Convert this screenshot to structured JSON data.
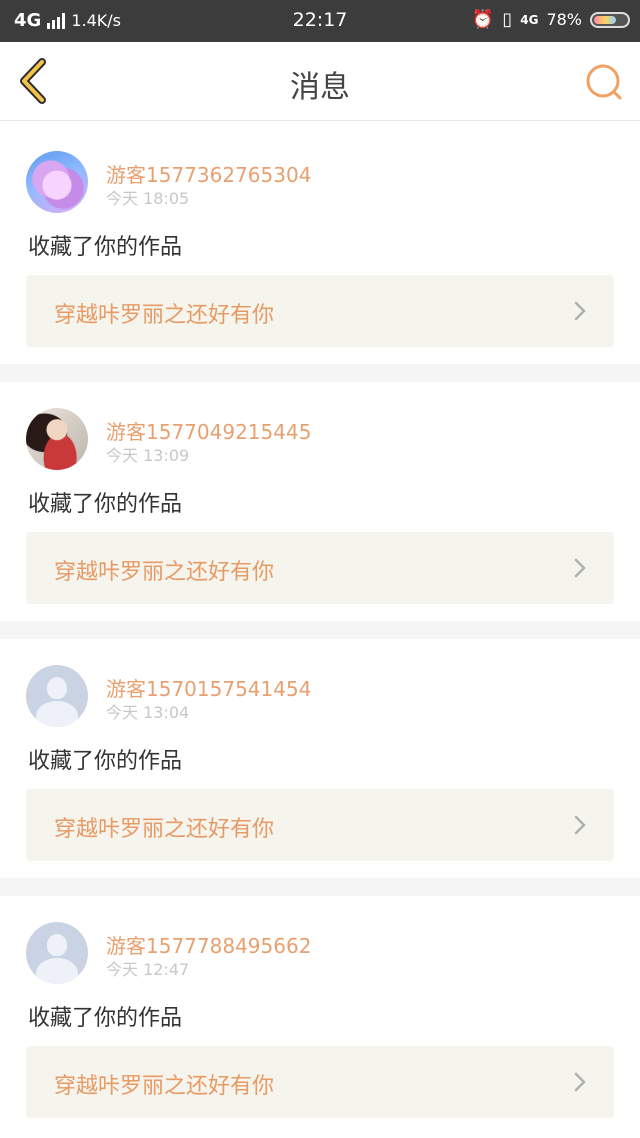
{
  "status_bar": {
    "network": "4G",
    "speed": "1.4K/s",
    "time": "22:17",
    "network_right": "4G",
    "battery": "78%",
    "colors": {
      "bg": "#3c3c3c",
      "text": "#ffffff"
    }
  },
  "header": {
    "title": "消息",
    "back_icon": "chevron-left-icon",
    "search_icon": "search-icon",
    "accent_color": "#f0a060"
  },
  "messages": [
    {
      "username": "游客1577362765304",
      "time": "今天  18:05",
      "action": "收藏了你的作品",
      "work_title": "穿越咔罗丽之还好有你",
      "avatar": "flower"
    },
    {
      "username": "游客1577049215445",
      "time": "今天  13:09",
      "action": "收藏了你的作品",
      "work_title": "穿越咔罗丽之还好有你",
      "avatar": "photo"
    },
    {
      "username": "游客1570157541454",
      "time": "今天  13:04",
      "action": "收藏了你的作品",
      "work_title": "穿越咔罗丽之还好有你",
      "avatar": "default"
    },
    {
      "username": "游客1577788495662",
      "time": "今天  12:47",
      "action": "收藏了你的作品",
      "work_title": "穿越咔罗丽之还好有你",
      "avatar": "default"
    }
  ]
}
